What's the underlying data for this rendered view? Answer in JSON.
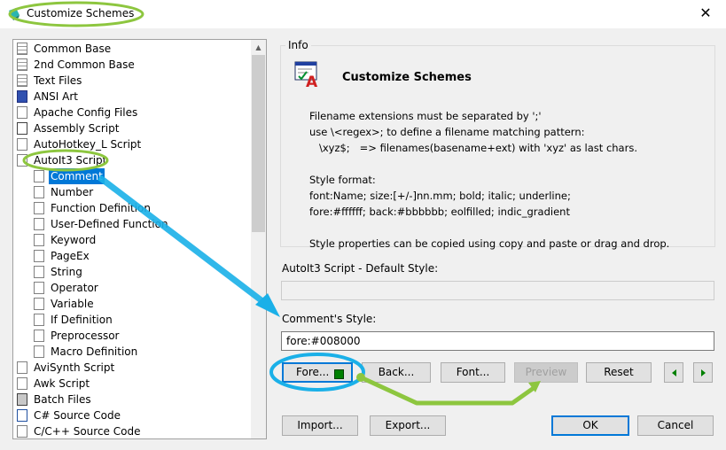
{
  "window": {
    "title": "Customize Schemes",
    "close_glyph": "✕"
  },
  "tree": {
    "items": [
      {
        "label": "Common Base",
        "icon": "doc-lines-icon",
        "level": 0
      },
      {
        "label": "2nd Common Base",
        "icon": "doc-lines-icon",
        "level": 0
      },
      {
        "label": "Text Files",
        "icon": "doc-lines-icon",
        "level": 0
      },
      {
        "label": "ANSI Art",
        "icon": "ansi-art-icon",
        "level": 0
      },
      {
        "label": "Apache Config Files",
        "icon": "doc-icon",
        "level": 0
      },
      {
        "label": "Assembly Script",
        "icon": "asm-icon",
        "level": 0
      },
      {
        "label": "AutoHotkey_L Script",
        "icon": "doc-icon",
        "level": 0
      },
      {
        "label": "AutoIt3 Script",
        "icon": "doc-icon",
        "level": 0
      },
      {
        "label": "Comment",
        "icon": "doc-icon",
        "level": 1,
        "selected": true
      },
      {
        "label": "Number",
        "icon": "doc-icon",
        "level": 1
      },
      {
        "label": "Function Definition",
        "icon": "doc-icon",
        "level": 1
      },
      {
        "label": "User-Defined Function",
        "icon": "doc-icon",
        "level": 1
      },
      {
        "label": "Keyword",
        "icon": "doc-icon",
        "level": 1
      },
      {
        "label": "PageEx",
        "icon": "doc-icon",
        "level": 1
      },
      {
        "label": "String",
        "icon": "doc-icon",
        "level": 1
      },
      {
        "label": "Operator",
        "icon": "doc-icon",
        "level": 1
      },
      {
        "label": "Variable",
        "icon": "doc-icon",
        "level": 1
      },
      {
        "label": "If Definition",
        "icon": "doc-icon",
        "level": 1
      },
      {
        "label": "Preprocessor",
        "icon": "doc-icon",
        "level": 1
      },
      {
        "label": "Macro Definition",
        "icon": "doc-icon",
        "level": 1
      },
      {
        "label": "AviSynth Script",
        "icon": "doc-icon",
        "level": 0
      },
      {
        "label": "Awk Script",
        "icon": "doc-icon",
        "level": 0
      },
      {
        "label": "Batch Files",
        "icon": "batch-icon",
        "level": 0
      },
      {
        "label": "C# Source Code",
        "icon": "csharp-icon",
        "level": 0
      },
      {
        "label": "C/C++ Source Code",
        "icon": "doc-icon",
        "level": 0
      }
    ]
  },
  "info": {
    "legend": "Info",
    "title": "Customize Schemes",
    "lines": [
      "Filename extensions must be separated by ';'",
      "use \\<regex>; to define a filename matching pattern:",
      "   \\xyz$;   => filenames(basename+ext) with 'xyz' as last chars.",
      "",
      "Style format:",
      "font:Name; size:[+/-]nn.mm; bold; italic; underline;",
      "fore:#ffffff; back:#bbbbbb; eolfilled; indic_gradient",
      "",
      "Style properties can be copied using copy and paste or drag and drop."
    ]
  },
  "default_style": {
    "label": "AutoIt3 Script - Default Style:",
    "value": ""
  },
  "item_style": {
    "label": "Comment's  Style:",
    "value": "fore:#008000"
  },
  "buttons": {
    "fore": "Fore...",
    "back": "Back...",
    "font": "Font...",
    "preview": "Preview",
    "reset": "Reset",
    "import": "Import...",
    "export": "Export...",
    "ok": "OK",
    "cancel": "Cancel"
  },
  "colors": {
    "accent": "#0078d7",
    "swatch": "#008000",
    "highlight_green": "#8dc63f",
    "highlight_blue": "#1ab0e8"
  }
}
